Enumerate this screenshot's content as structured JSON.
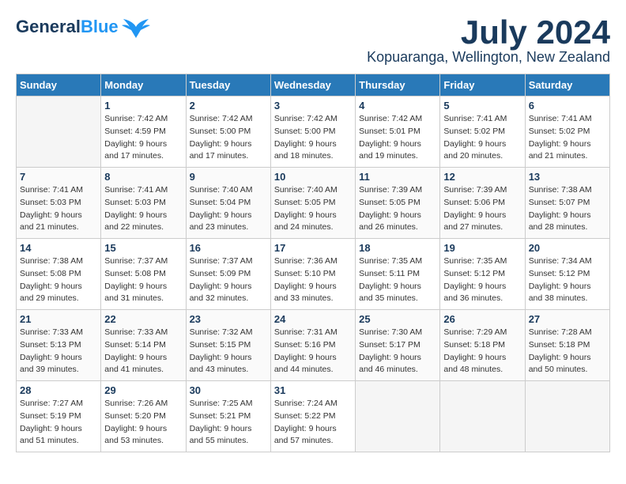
{
  "logo": {
    "text_general": "General",
    "text_blue": "Blue"
  },
  "title": "July 2024",
  "location": "Kopuaranga, Wellington, New Zealand",
  "days_of_week": [
    "Sunday",
    "Monday",
    "Tuesday",
    "Wednesday",
    "Thursday",
    "Friday",
    "Saturday"
  ],
  "weeks": [
    [
      {
        "day": "",
        "empty": true
      },
      {
        "day": "1",
        "sunrise": "7:42 AM",
        "sunset": "4:59 PM",
        "daylight": "9 hours and 17 minutes."
      },
      {
        "day": "2",
        "sunrise": "7:42 AM",
        "sunset": "5:00 PM",
        "daylight": "9 hours and 17 minutes."
      },
      {
        "day": "3",
        "sunrise": "7:42 AM",
        "sunset": "5:00 PM",
        "daylight": "9 hours and 18 minutes."
      },
      {
        "day": "4",
        "sunrise": "7:42 AM",
        "sunset": "5:01 PM",
        "daylight": "9 hours and 19 minutes."
      },
      {
        "day": "5",
        "sunrise": "7:41 AM",
        "sunset": "5:02 PM",
        "daylight": "9 hours and 20 minutes."
      },
      {
        "day": "6",
        "sunrise": "7:41 AM",
        "sunset": "5:02 PM",
        "daylight": "9 hours and 21 minutes."
      }
    ],
    [
      {
        "day": "7",
        "sunrise": "7:41 AM",
        "sunset": "5:03 PM",
        "daylight": "9 hours and 21 minutes."
      },
      {
        "day": "8",
        "sunrise": "7:41 AM",
        "sunset": "5:03 PM",
        "daylight": "9 hours and 22 minutes."
      },
      {
        "day": "9",
        "sunrise": "7:40 AM",
        "sunset": "5:04 PM",
        "daylight": "9 hours and 23 minutes."
      },
      {
        "day": "10",
        "sunrise": "7:40 AM",
        "sunset": "5:05 PM",
        "daylight": "9 hours and 24 minutes."
      },
      {
        "day": "11",
        "sunrise": "7:39 AM",
        "sunset": "5:05 PM",
        "daylight": "9 hours and 26 minutes."
      },
      {
        "day": "12",
        "sunrise": "7:39 AM",
        "sunset": "5:06 PM",
        "daylight": "9 hours and 27 minutes."
      },
      {
        "day": "13",
        "sunrise": "7:38 AM",
        "sunset": "5:07 PM",
        "daylight": "9 hours and 28 minutes."
      }
    ],
    [
      {
        "day": "14",
        "sunrise": "7:38 AM",
        "sunset": "5:08 PM",
        "daylight": "9 hours and 29 minutes."
      },
      {
        "day": "15",
        "sunrise": "7:37 AM",
        "sunset": "5:08 PM",
        "daylight": "9 hours and 31 minutes."
      },
      {
        "day": "16",
        "sunrise": "7:37 AM",
        "sunset": "5:09 PM",
        "daylight": "9 hours and 32 minutes."
      },
      {
        "day": "17",
        "sunrise": "7:36 AM",
        "sunset": "5:10 PM",
        "daylight": "9 hours and 33 minutes."
      },
      {
        "day": "18",
        "sunrise": "7:35 AM",
        "sunset": "5:11 PM",
        "daylight": "9 hours and 35 minutes."
      },
      {
        "day": "19",
        "sunrise": "7:35 AM",
        "sunset": "5:12 PM",
        "daylight": "9 hours and 36 minutes."
      },
      {
        "day": "20",
        "sunrise": "7:34 AM",
        "sunset": "5:12 PM",
        "daylight": "9 hours and 38 minutes."
      }
    ],
    [
      {
        "day": "21",
        "sunrise": "7:33 AM",
        "sunset": "5:13 PM",
        "daylight": "9 hours and 39 minutes."
      },
      {
        "day": "22",
        "sunrise": "7:33 AM",
        "sunset": "5:14 PM",
        "daylight": "9 hours and 41 minutes."
      },
      {
        "day": "23",
        "sunrise": "7:32 AM",
        "sunset": "5:15 PM",
        "daylight": "9 hours and 43 minutes."
      },
      {
        "day": "24",
        "sunrise": "7:31 AM",
        "sunset": "5:16 PM",
        "daylight": "9 hours and 44 minutes."
      },
      {
        "day": "25",
        "sunrise": "7:30 AM",
        "sunset": "5:17 PM",
        "daylight": "9 hours and 46 minutes."
      },
      {
        "day": "26",
        "sunrise": "7:29 AM",
        "sunset": "5:18 PM",
        "daylight": "9 hours and 48 minutes."
      },
      {
        "day": "27",
        "sunrise": "7:28 AM",
        "sunset": "5:18 PM",
        "daylight": "9 hours and 50 minutes."
      }
    ],
    [
      {
        "day": "28",
        "sunrise": "7:27 AM",
        "sunset": "5:19 PM",
        "daylight": "9 hours and 51 minutes."
      },
      {
        "day": "29",
        "sunrise": "7:26 AM",
        "sunset": "5:20 PM",
        "daylight": "9 hours and 53 minutes."
      },
      {
        "day": "30",
        "sunrise": "7:25 AM",
        "sunset": "5:21 PM",
        "daylight": "9 hours and 55 minutes."
      },
      {
        "day": "31",
        "sunrise": "7:24 AM",
        "sunset": "5:22 PM",
        "daylight": "9 hours and 57 minutes."
      },
      {
        "day": "",
        "empty": true
      },
      {
        "day": "",
        "empty": true
      },
      {
        "day": "",
        "empty": true
      }
    ]
  ]
}
